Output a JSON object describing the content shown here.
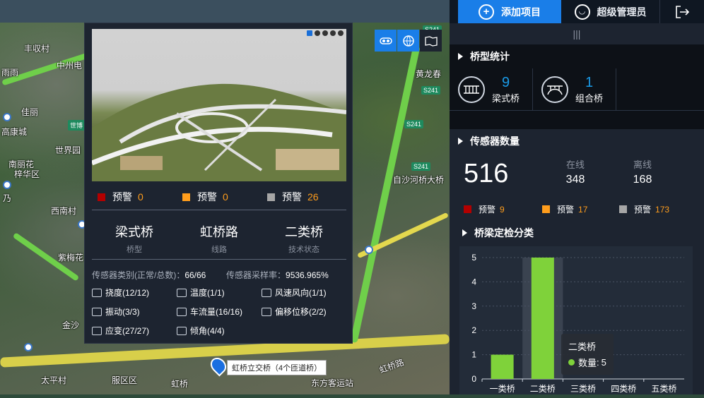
{
  "map": {
    "labels": [
      "丰収村",
      "中州电",
      "雨雨",
      "佳丽",
      "高康城",
      "世界园",
      "南丽花",
      "梓华区",
      "乃",
      "西南村",
      "紫梅花",
      "金沙",
      "太平村",
      "服区区",
      "虹桥",
      "东方客运站",
      "自沙河桥大桥",
      "黄龙春",
      "虹桥路"
    ],
    "highways": [
      "S241",
      "S241",
      "S241",
      "S241",
      "世博"
    ],
    "marker_label": "虹桥立交桥（4个匝道桥）"
  },
  "popup": {
    "warnings": [
      {
        "label": "预警",
        "value": "0",
        "color": "#b30000"
      },
      {
        "label": "预警",
        "value": "0",
        "color": "#ff9d1c"
      },
      {
        "label": "预警",
        "value": "26",
        "color": "#a6a6a6"
      }
    ],
    "info": [
      {
        "value": "梁式桥",
        "key": "桥型"
      },
      {
        "value": "虹桥路",
        "key": "线路"
      },
      {
        "value": "二类桥",
        "key": "技术状态"
      }
    ],
    "sensor_type_label": "传感器类别(正常/总数)：",
    "sensor_type_value": "66/66",
    "sample_rate_label": "传感器采样率：",
    "sample_rate_value": "9536.965%",
    "sensors": [
      {
        "label": "挠度(12/12)",
        "icon": "deflection-icon"
      },
      {
        "label": "温度(1/1)",
        "icon": "thermometer-icon"
      },
      {
        "label": "风速风向(1/1)",
        "icon": "wind-flag-icon"
      },
      {
        "label": "振动(3/3)",
        "icon": "vibration-icon"
      },
      {
        "label": "车流量(16/16)",
        "icon": "traffic-icon"
      },
      {
        "label": "偏移位移(2/2)",
        "icon": "displacement-icon"
      },
      {
        "label": "应变(27/27)",
        "icon": "strain-icon"
      },
      {
        "label": "倾角(4/4)",
        "icon": "tilt-icon"
      }
    ]
  },
  "topbar": {
    "add_label": "添加项目",
    "user_label": "超级管理员"
  },
  "panel": {
    "handle": "|||",
    "bridge_stats_title": "桥型统计",
    "bridge_types": [
      {
        "num": "9",
        "label": "梁式桥"
      },
      {
        "num": "1",
        "label": "组合桥"
      }
    ],
    "sensor_title": "传感器数量",
    "sensor_total": "516",
    "online_label": "在线",
    "online_value": "348",
    "offline_label": "离线",
    "offline_value": "168",
    "warnings": [
      {
        "label": "预警",
        "value": "9",
        "color": "#b30000"
      },
      {
        "label": "预警",
        "value": "17",
        "color": "#ff9d1c"
      },
      {
        "label": "预警",
        "value": "173",
        "color": "#a6a6a6"
      }
    ],
    "chart_title": "桥梁定检分类"
  },
  "chart_data": {
    "type": "bar",
    "categories": [
      "一类桥",
      "二类桥",
      "三类桥",
      "四类桥",
      "五类桥"
    ],
    "values": [
      1,
      5,
      0,
      0,
      0
    ],
    "ylim": [
      0,
      5
    ],
    "yticks": [
      "0",
      "1",
      "2",
      "3",
      "4",
      "5"
    ],
    "grid": true,
    "highlight_index": 1,
    "colors": {
      "bar": "#7fd23a",
      "bar1": "#7fd23a",
      "highlight_band": "#3a4350"
    },
    "tooltip": {
      "title": "二类桥",
      "label": "数量",
      "value": "5"
    }
  }
}
